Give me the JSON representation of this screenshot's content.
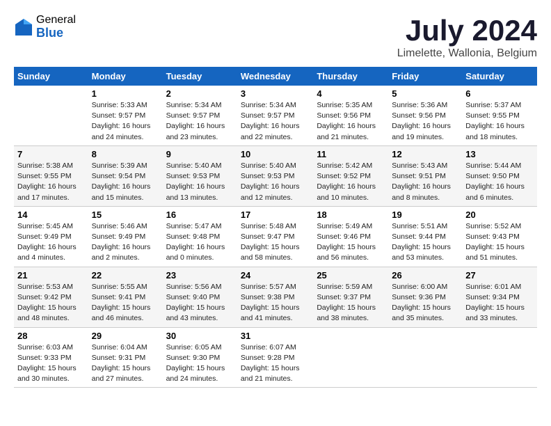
{
  "header": {
    "logo_general": "General",
    "logo_blue": "Blue",
    "month_title": "July 2024",
    "location": "Limelette, Wallonia, Belgium"
  },
  "weekdays": [
    "Sunday",
    "Monday",
    "Tuesday",
    "Wednesday",
    "Thursday",
    "Friday",
    "Saturday"
  ],
  "weeks": [
    [
      {
        "day": "",
        "info": ""
      },
      {
        "day": "1",
        "info": "Sunrise: 5:33 AM\nSunset: 9:57 PM\nDaylight: 16 hours\nand 24 minutes."
      },
      {
        "day": "2",
        "info": "Sunrise: 5:34 AM\nSunset: 9:57 PM\nDaylight: 16 hours\nand 23 minutes."
      },
      {
        "day": "3",
        "info": "Sunrise: 5:34 AM\nSunset: 9:57 PM\nDaylight: 16 hours\nand 22 minutes."
      },
      {
        "day": "4",
        "info": "Sunrise: 5:35 AM\nSunset: 9:56 PM\nDaylight: 16 hours\nand 21 minutes."
      },
      {
        "day": "5",
        "info": "Sunrise: 5:36 AM\nSunset: 9:56 PM\nDaylight: 16 hours\nand 19 minutes."
      },
      {
        "day": "6",
        "info": "Sunrise: 5:37 AM\nSunset: 9:55 PM\nDaylight: 16 hours\nand 18 minutes."
      }
    ],
    [
      {
        "day": "7",
        "info": "Sunrise: 5:38 AM\nSunset: 9:55 PM\nDaylight: 16 hours\nand 17 minutes."
      },
      {
        "day": "8",
        "info": "Sunrise: 5:39 AM\nSunset: 9:54 PM\nDaylight: 16 hours\nand 15 minutes."
      },
      {
        "day": "9",
        "info": "Sunrise: 5:40 AM\nSunset: 9:53 PM\nDaylight: 16 hours\nand 13 minutes."
      },
      {
        "day": "10",
        "info": "Sunrise: 5:40 AM\nSunset: 9:53 PM\nDaylight: 16 hours\nand 12 minutes."
      },
      {
        "day": "11",
        "info": "Sunrise: 5:42 AM\nSunset: 9:52 PM\nDaylight: 16 hours\nand 10 minutes."
      },
      {
        "day": "12",
        "info": "Sunrise: 5:43 AM\nSunset: 9:51 PM\nDaylight: 16 hours\nand 8 minutes."
      },
      {
        "day": "13",
        "info": "Sunrise: 5:44 AM\nSunset: 9:50 PM\nDaylight: 16 hours\nand 6 minutes."
      }
    ],
    [
      {
        "day": "14",
        "info": "Sunrise: 5:45 AM\nSunset: 9:49 PM\nDaylight: 16 hours\nand 4 minutes."
      },
      {
        "day": "15",
        "info": "Sunrise: 5:46 AM\nSunset: 9:49 PM\nDaylight: 16 hours\nand 2 minutes."
      },
      {
        "day": "16",
        "info": "Sunrise: 5:47 AM\nSunset: 9:48 PM\nDaylight: 16 hours\nand 0 minutes."
      },
      {
        "day": "17",
        "info": "Sunrise: 5:48 AM\nSunset: 9:47 PM\nDaylight: 15 hours\nand 58 minutes."
      },
      {
        "day": "18",
        "info": "Sunrise: 5:49 AM\nSunset: 9:46 PM\nDaylight: 15 hours\nand 56 minutes."
      },
      {
        "day": "19",
        "info": "Sunrise: 5:51 AM\nSunset: 9:44 PM\nDaylight: 15 hours\nand 53 minutes."
      },
      {
        "day": "20",
        "info": "Sunrise: 5:52 AM\nSunset: 9:43 PM\nDaylight: 15 hours\nand 51 minutes."
      }
    ],
    [
      {
        "day": "21",
        "info": "Sunrise: 5:53 AM\nSunset: 9:42 PM\nDaylight: 15 hours\nand 48 minutes."
      },
      {
        "day": "22",
        "info": "Sunrise: 5:55 AM\nSunset: 9:41 PM\nDaylight: 15 hours\nand 46 minutes."
      },
      {
        "day": "23",
        "info": "Sunrise: 5:56 AM\nSunset: 9:40 PM\nDaylight: 15 hours\nand 43 minutes."
      },
      {
        "day": "24",
        "info": "Sunrise: 5:57 AM\nSunset: 9:38 PM\nDaylight: 15 hours\nand 41 minutes."
      },
      {
        "day": "25",
        "info": "Sunrise: 5:59 AM\nSunset: 9:37 PM\nDaylight: 15 hours\nand 38 minutes."
      },
      {
        "day": "26",
        "info": "Sunrise: 6:00 AM\nSunset: 9:36 PM\nDaylight: 15 hours\nand 35 minutes."
      },
      {
        "day": "27",
        "info": "Sunrise: 6:01 AM\nSunset: 9:34 PM\nDaylight: 15 hours\nand 33 minutes."
      }
    ],
    [
      {
        "day": "28",
        "info": "Sunrise: 6:03 AM\nSunset: 9:33 PM\nDaylight: 15 hours\nand 30 minutes."
      },
      {
        "day": "29",
        "info": "Sunrise: 6:04 AM\nSunset: 9:31 PM\nDaylight: 15 hours\nand 27 minutes."
      },
      {
        "day": "30",
        "info": "Sunrise: 6:05 AM\nSunset: 9:30 PM\nDaylight: 15 hours\nand 24 minutes."
      },
      {
        "day": "31",
        "info": "Sunrise: 6:07 AM\nSunset: 9:28 PM\nDaylight: 15 hours\nand 21 minutes."
      },
      {
        "day": "",
        "info": ""
      },
      {
        "day": "",
        "info": ""
      },
      {
        "day": "",
        "info": ""
      }
    ]
  ]
}
